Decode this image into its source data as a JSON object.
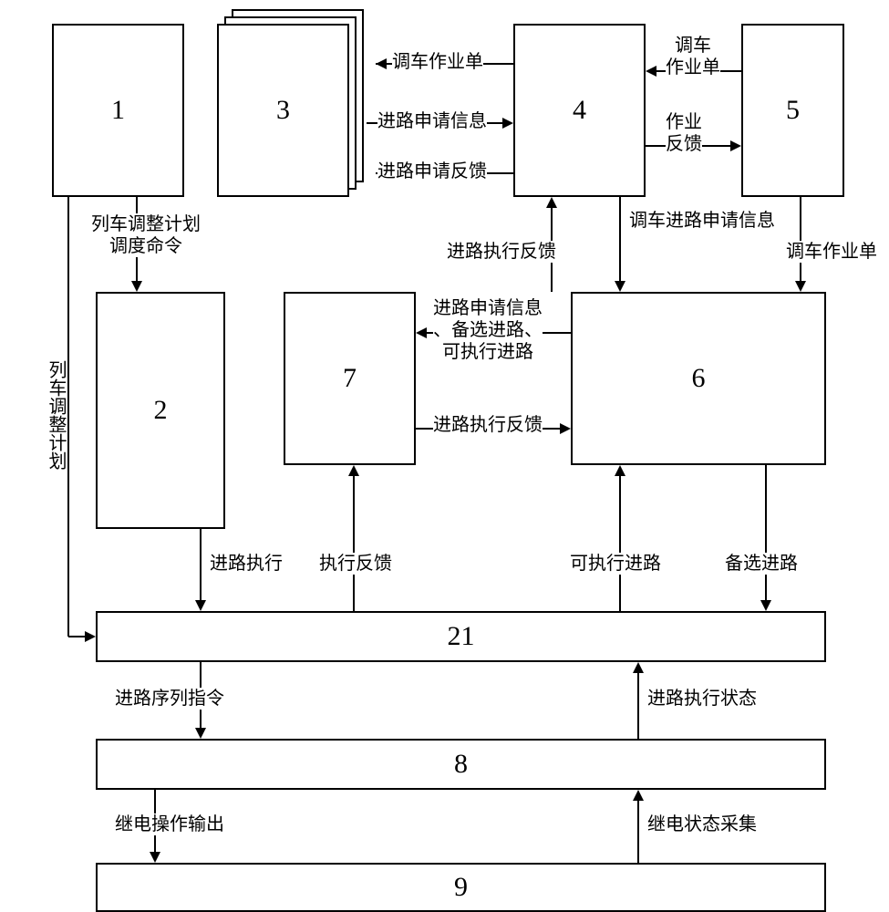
{
  "nodes": {
    "b1": "1",
    "b2": "2",
    "b3": "3",
    "b4": "4",
    "b5": "5",
    "b6": "6",
    "b7": "7",
    "b8": "8",
    "b9": "9",
    "b21": "21"
  },
  "edges": {
    "e3_4_top": "调车作业单",
    "e3_4_mid": "进路申请信息",
    "e3_4_bot": "进路申请反馈",
    "e4_5_top": "调车\n作业单",
    "e4_5_bot": "作业\n反馈",
    "e1_2": "列车调整计划\n调度命令",
    "e1_21": "列车调整计划",
    "e4_6_left": "进路执行反馈",
    "e4_6_right": "调车进路申请信息",
    "e5_6": "调车作业单",
    "e6_7_top": "进路申请信息\n、备选进路、\n可执行进路",
    "e6_7_bot": "进路执行反馈",
    "e2_21": "进路执行",
    "e7_21": "执行反馈",
    "e6_21_left": "可执行进路",
    "e6_21_right": "备选进路",
    "e21_8_left": "进路序列指令",
    "e21_8_right": "进路执行状态",
    "e8_9_left": "继电操作输出",
    "e8_9_right": "继电状态采集"
  }
}
